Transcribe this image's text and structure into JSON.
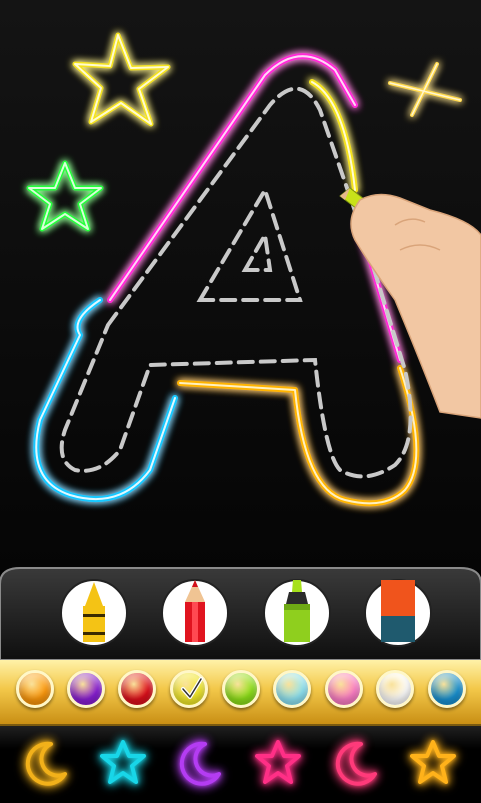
{
  "drawing": {
    "letter": "A",
    "colors": {
      "pink": "#ff2bd6",
      "yellow": "#f4e21a",
      "blue": "#17c8ff",
      "orange": "#ffb400",
      "green": "#22ff3a",
      "gold": "#ffd84a"
    }
  },
  "tools": [
    {
      "name": "crayon",
      "icon": "crayon-icon"
    },
    {
      "name": "pencil",
      "icon": "pencil-icon"
    },
    {
      "name": "marker",
      "icon": "marker-icon"
    },
    {
      "name": "eraser",
      "icon": "eraser-icon"
    }
  ],
  "palette": {
    "selected_index": 3,
    "swatches": [
      "#ff9a0d",
      "#8a1fd6",
      "#e0101c",
      "#f4ec2a",
      "#8ee21a",
      "#8fe6f6",
      "#ff7fc8",
      "#ffffff",
      "#1a93d4"
    ]
  },
  "stamps": [
    {
      "shape": "moon",
      "color": "#f2b11a"
    },
    {
      "shape": "star",
      "color": "#18d6e8"
    },
    {
      "shape": "moon",
      "color": "#b43cf2"
    },
    {
      "shape": "star",
      "color": "#ff2f86"
    },
    {
      "shape": "moon",
      "color": "#ff3a7a"
    },
    {
      "shape": "star",
      "color": "#ffb21a"
    }
  ]
}
